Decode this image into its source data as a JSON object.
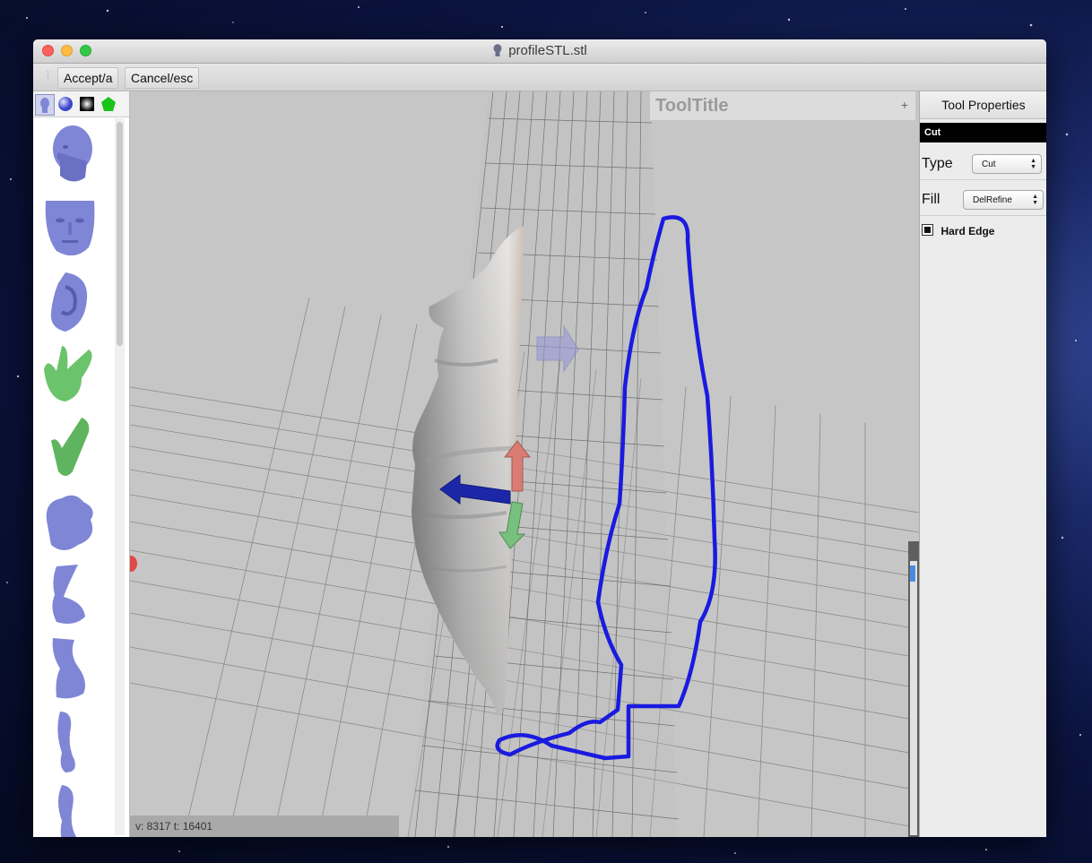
{
  "window": {
    "title": "profileSTL.stl"
  },
  "toolbar": {
    "accept_label": "Accept/a",
    "cancel_label": "Cancel/esc"
  },
  "library": {
    "tabs": [
      "head-models-icon",
      "sphere-icon",
      "gradient-stamp-icon",
      "pentagon-icon"
    ],
    "items": [
      "head-model-icon",
      "face-model-icon",
      "ear-model-icon",
      "hand-model-icon",
      "finger-model-icon",
      "nose-model-icon",
      "leg-model-icon",
      "foot-model-icon",
      "limb-model-icon",
      "limb-model-icon"
    ]
  },
  "viewport": {
    "tool_title": "ToolTitle",
    "tool_title_plus": "+",
    "status": "v: 8317  t: 16401"
  },
  "properties": {
    "header": "Tool Properties",
    "tool_name": "Cut",
    "type_label": "Type",
    "type_value": "Cut",
    "fill_label": "Fill",
    "fill_value": "DelRefine",
    "hard_edge_label": "Hard Edge",
    "hard_edge_checked": true
  },
  "colors": {
    "curve": "#1a1ae0",
    "model_purple": "#7f86d6",
    "model_green": "#6bc46b",
    "arrow_blue": "#1c27a8",
    "arrow_red": "#d97c73",
    "arrow_green": "#77c07d"
  }
}
